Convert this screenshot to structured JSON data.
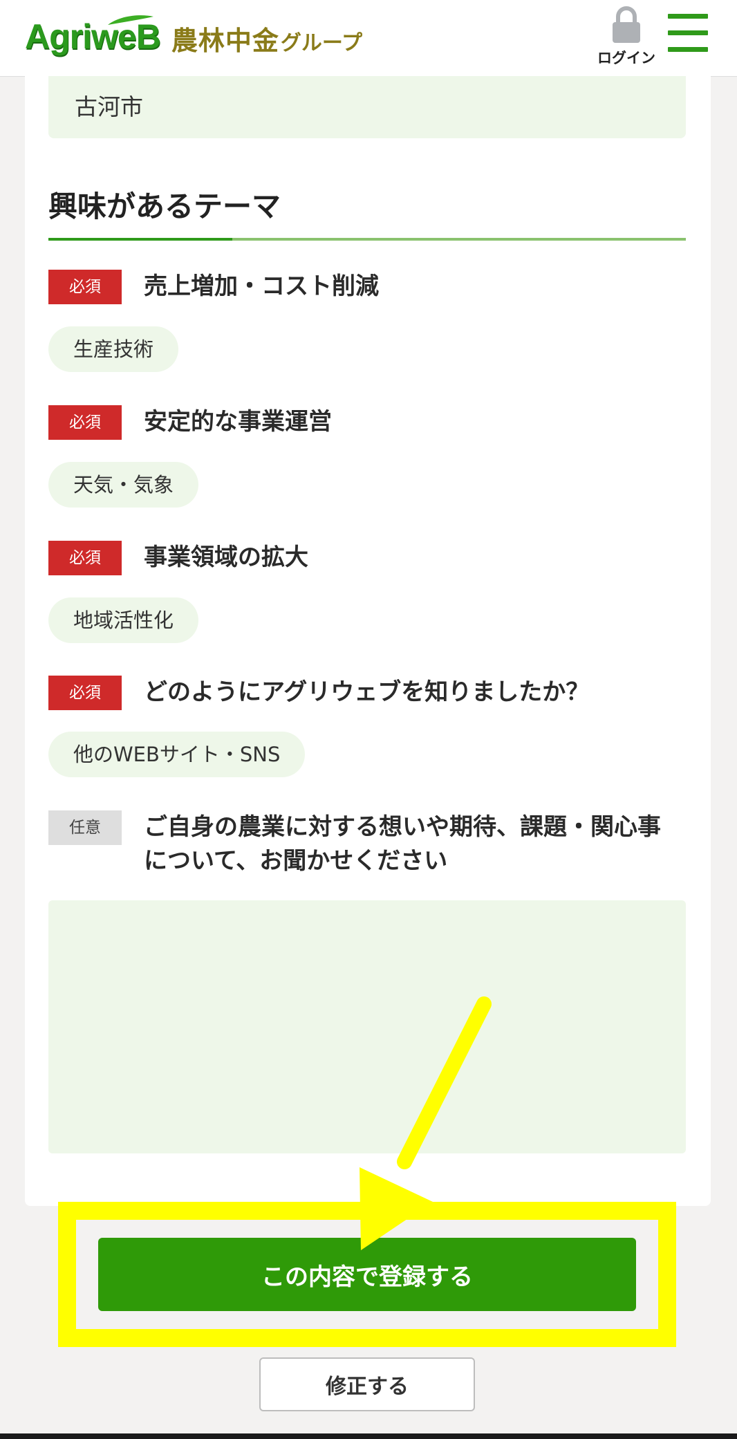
{
  "header": {
    "logo_brand": "AgriweB",
    "logo_group_main": "農林中金",
    "logo_group_sub": "グループ",
    "login_label": "ログイン"
  },
  "form": {
    "city_value": "古河市",
    "section_title": "興味があるテーマ",
    "questions": [
      {
        "badge": "必須",
        "label": "売上増加・コスト削減",
        "answer": "生産技術"
      },
      {
        "badge": "必須",
        "label": "安定的な事業運営",
        "answer": "天気・気象"
      },
      {
        "badge": "必須",
        "label": "事業領域の拡大",
        "answer": "地域活性化"
      },
      {
        "badge": "必須",
        "label": "どのようにアグリウェブを知りましたか？",
        "answer": "他のWEBサイト・SNS"
      },
      {
        "badge": "任意",
        "label": "ご自身の農業に対する想いや期待、課題・関心事について、お聞かせください",
        "answer": ""
      }
    ]
  },
  "actions": {
    "submit_label": "この内容で登録する",
    "edit_label": "修正する"
  },
  "colors": {
    "brand_green": "#2f9a1a",
    "required_red": "#cf2a2a",
    "field_bg": "#eef7e9",
    "highlight_yellow": "#ffff00"
  }
}
